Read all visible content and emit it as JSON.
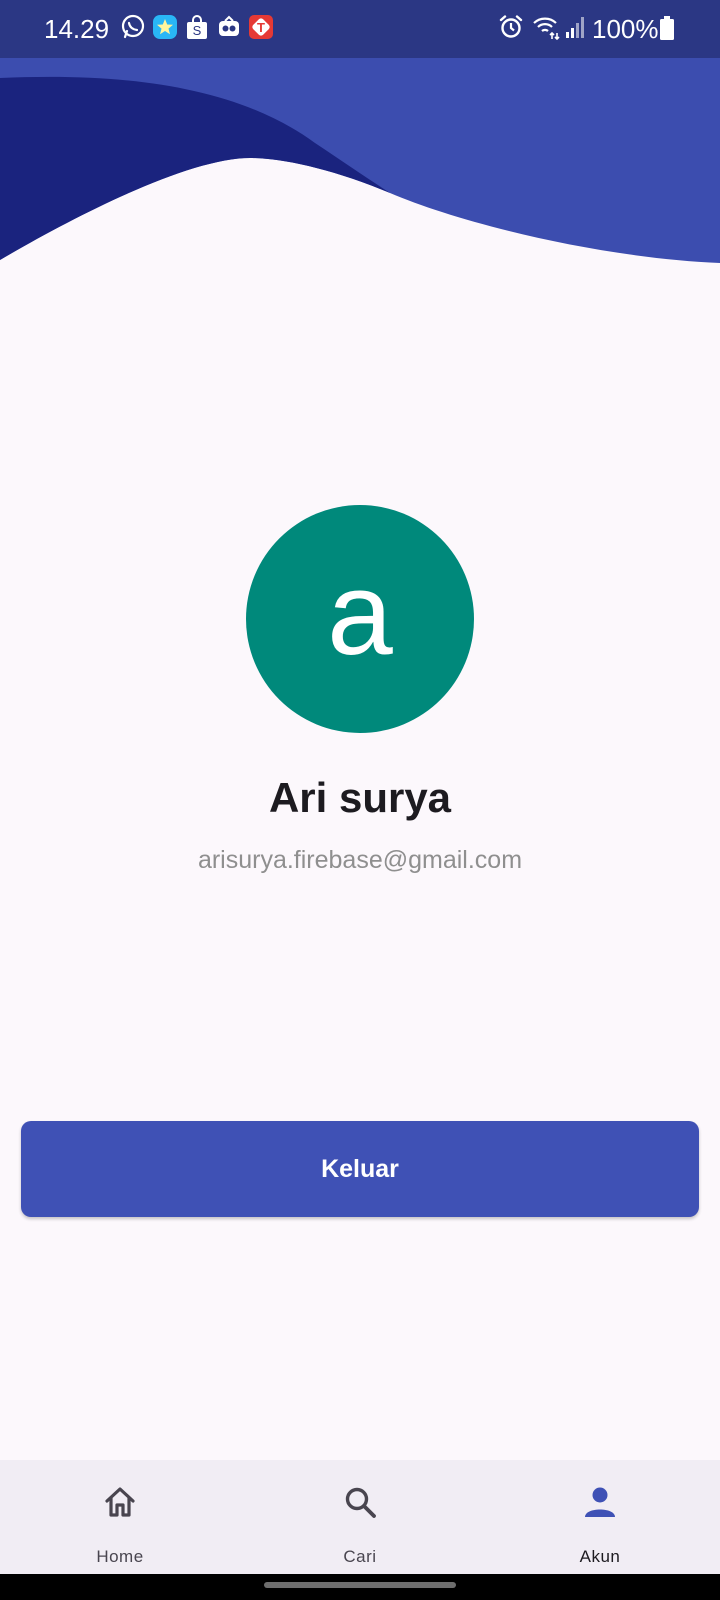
{
  "status_bar": {
    "time": "14.29",
    "battery": "100%",
    "left_icons": [
      "whatsapp-icon",
      "star-app-icon",
      "shopee-icon",
      "game-app-icon",
      "telkomsel-icon"
    ],
    "right_icons": [
      "alarm-icon",
      "wifi-icon",
      "signal-icon",
      "battery-icon"
    ]
  },
  "colors": {
    "status_bar": "#2b3784",
    "wave_back": "#3c4daf",
    "wave_front": "#1a237e",
    "background": "#fcf8fc",
    "avatar": "#00897b",
    "button": "#3f51b5",
    "nav_background": "#f1edf4",
    "nav_active": "#3f51b5"
  },
  "profile": {
    "avatar_letter": "a",
    "name": "Ari surya",
    "email": "arisurya.firebase@gmail.com"
  },
  "actions": {
    "logout_label": "Keluar"
  },
  "bottom_nav": {
    "active_index": 2,
    "items": [
      {
        "label": "Home",
        "icon": "home-icon"
      },
      {
        "label": "Cari",
        "icon": "search-icon"
      },
      {
        "label": "Akun",
        "icon": "person-icon"
      }
    ]
  }
}
